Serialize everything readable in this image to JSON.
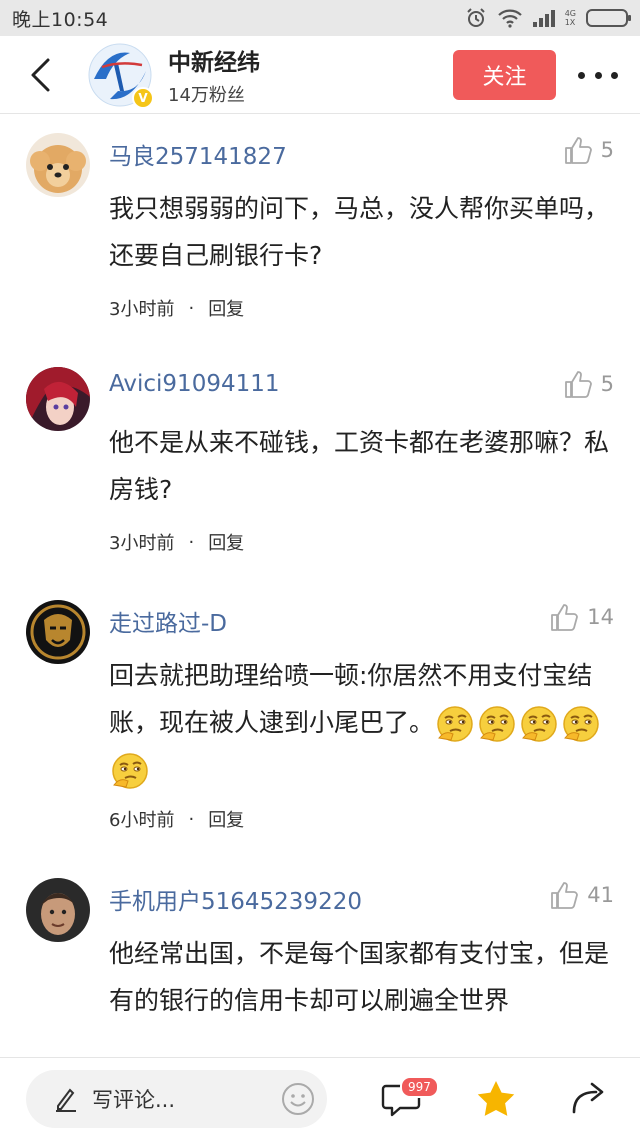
{
  "status_bar": {
    "time": "晚上10:54",
    "network_top": "4G",
    "network_bottom": "1X"
  },
  "header": {
    "channel_name": "中新经纬",
    "fans": "14万粉丝",
    "follow_label": "关注"
  },
  "comments": [
    {
      "user": "马良257141827",
      "likes": "5",
      "text": "我只想弱弱的问下，马总，没人帮你买单吗，还要自己刷银行卡?",
      "time": "3小时前",
      "reply": "回复"
    },
    {
      "user": "Avici91094111",
      "likes": "5",
      "text": "他不是从来不碰钱，工资卡都在老婆那嘛？私房钱?",
      "time": "3小时前",
      "reply": "回复"
    },
    {
      "user": "走过路过-D",
      "likes": "14",
      "text": "回去就把助理给喷一顿:你居然不用支付宝结账，现在被人逮到小尾巴了。",
      "emoji_count": 5,
      "time": "6小时前",
      "reply": "回复"
    },
    {
      "user": "手机用户51645239220",
      "likes": "41",
      "text": "他经常出国，不是每个国家都有支付宝，但是有的银行的信用卡却可以刷遍全世界"
    }
  ],
  "bottom_bar": {
    "comment_placeholder": "写评论...",
    "comment_count_badge": "997"
  },
  "colors": {
    "accent": "#f05a5a",
    "username": "#4a6a9e",
    "star": "#f7b500"
  }
}
